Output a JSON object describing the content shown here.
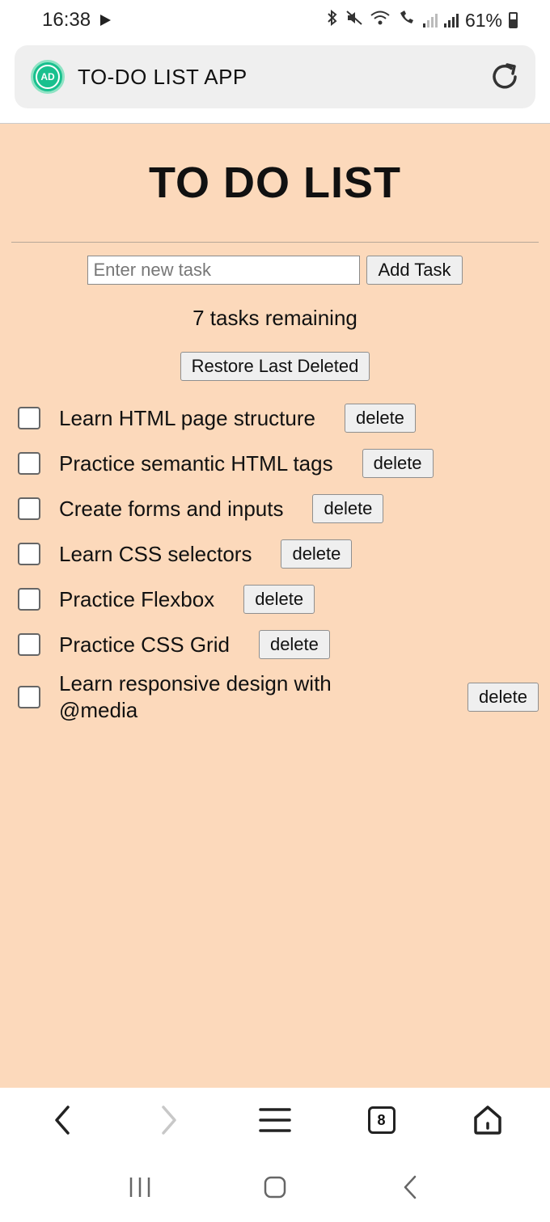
{
  "status_bar": {
    "time": "16:38",
    "battery": "61%",
    "icons": [
      "play-icon",
      "bluetooth-icon",
      "mute-icon",
      "wifi-icon",
      "wifi-call-icon",
      "signal-icon",
      "signal-icon",
      "battery-icon"
    ]
  },
  "browser": {
    "site_logo_text": "AD",
    "page_title": "TO-DO LIST APP",
    "tab_count": "8"
  },
  "app": {
    "heading": "TO DO LIST",
    "input_placeholder": "Enter new task",
    "input_value": "",
    "add_button": "Add Task",
    "remaining": "7 tasks remaining",
    "restore_button": "Restore Last Deleted",
    "tasks": [
      {
        "label": "Learn HTML page structure",
        "done": false,
        "delete_label": "delete"
      },
      {
        "label": "Practice semantic HTML tags",
        "done": false,
        "delete_label": "delete"
      },
      {
        "label": "Create forms and inputs",
        "done": false,
        "delete_label": "delete"
      },
      {
        "label": "Learn CSS selectors",
        "done": false,
        "delete_label": "delete"
      },
      {
        "label": "Practice Flexbox",
        "done": false,
        "delete_label": "delete"
      },
      {
        "label": "Practice CSS Grid",
        "done": false,
        "delete_label": "delete"
      },
      {
        "label": "Learn responsive design with @media",
        "done": false,
        "delete_label": "delete"
      }
    ]
  },
  "colors": {
    "page_background": "#fcd9bb",
    "site_logo": "#19c08e",
    "url_bar": "#efefef"
  }
}
